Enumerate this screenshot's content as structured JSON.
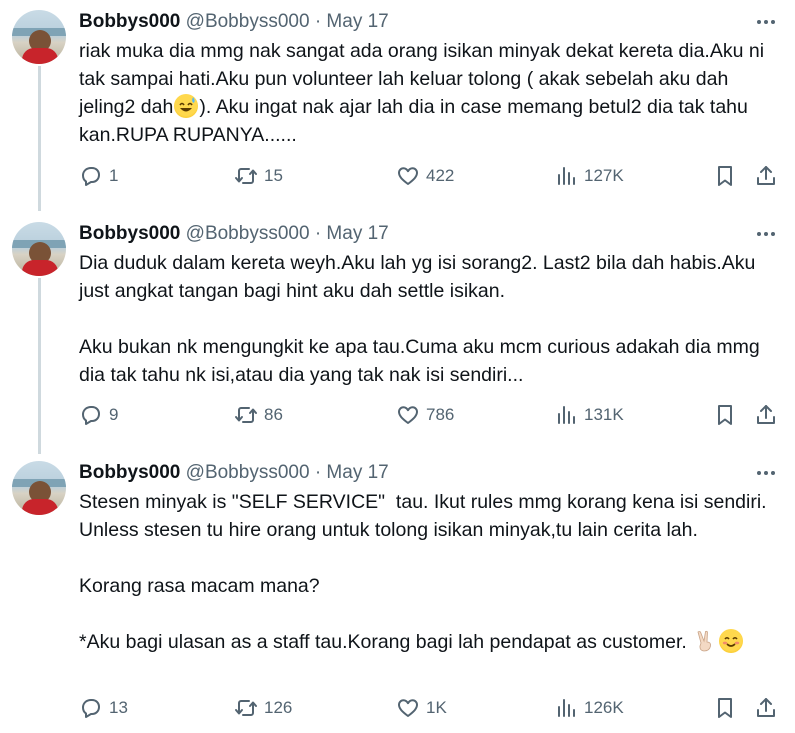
{
  "tweets": [
    {
      "name": "Bobbys000",
      "handle": "@Bobbyss000",
      "separator": "·",
      "date": "May 17",
      "text_part1": "riak muka dia mmg nak sangat ada orang isikan minyak dekat kereta dia.Aku ni tak sampai hati.Aku pun volunteer lah keluar tolong ( akak sebelah aku dah jeling2 dah",
      "text_emoji": "sweat-smile-emoji",
      "text_part2": "). Aku ingat nak ajar lah dia in case memang betul2 dia tak tahu kan.RUPA RUPANYA......",
      "replies": "1",
      "reposts": "15",
      "likes": "422",
      "views": "127K"
    },
    {
      "name": "Bobbys000",
      "handle": "@Bobbyss000",
      "separator": "·",
      "date": "May 17",
      "text": "Dia duduk dalam kereta weyh.Aku lah yg isi sorang2. Last2 bila dah habis.Aku just angkat tangan bagi hint aku dah settle isikan.\n\nAku bukan nk mengungkit ke apa tau.Cuma aku mcm curious adakah dia mmg dia tak tahu nk isi,atau dia yang tak nak isi sendiri...",
      "replies": "9",
      "reposts": "86",
      "likes": "786",
      "views": "131K"
    },
    {
      "name": "Bobbys000",
      "handle": "@Bobbyss000",
      "separator": "·",
      "date": "May 17",
      "text": "Stesen minyak is \"SELF SERVICE\"  tau. Ikut rules mmg korang kena isi sendiri. Unless stesen tu hire orang untuk tolong isikan minyak,tu lain cerita lah.\n\nKorang rasa macam mana?\n\n*Aku bagi ulasan as a staff tau.Korang bagi lah pendapat as customer.",
      "text_emojis": [
        "victory-hand-emoji",
        "smiling-face-emoji"
      ],
      "replies": "13",
      "reposts": "126",
      "likes": "1K",
      "views": "126K"
    }
  ],
  "icons": {
    "reply": "reply-icon",
    "repost": "repost-icon",
    "like": "heart-icon",
    "views": "views-chart-icon",
    "bookmark": "bookmark-icon",
    "share": "share-icon",
    "more": "more-dots-icon"
  },
  "colors": {
    "text": "#0f1419",
    "secondary": "#536471",
    "thread_line": "#cfd9de"
  }
}
